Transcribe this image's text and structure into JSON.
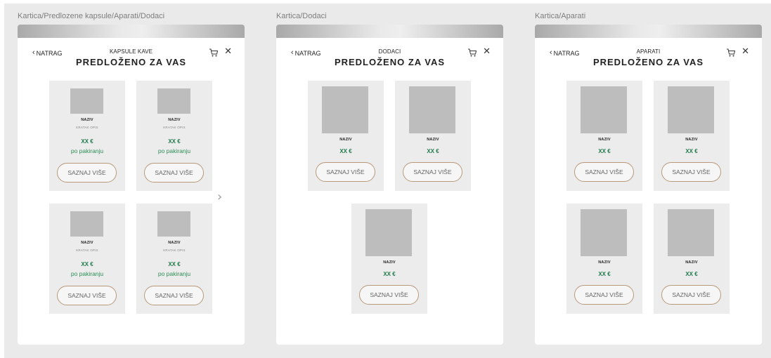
{
  "frames": [
    {
      "label": "Kartica/Predlozene kapsule/Aparati/Dodaci",
      "back": "NATRAG",
      "subtitle": "KAPSULE KAVE",
      "title": "PREDLOŽENO ZA VAS",
      "products": [
        {
          "name": "NAZIV",
          "desc": "KRATAK OPIS",
          "price": "XX €",
          "unit": "po pakiranju",
          "button": "SAZNAJ VIŠE"
        },
        {
          "name": "NAZIV",
          "desc": "KRATAK OPIS",
          "price": "XX €",
          "unit": "po pakiranju",
          "button": "SAZNAJ VIŠE"
        },
        {
          "name": "NAZIV",
          "desc": "KRATAK OPIS",
          "price": "XX €",
          "unit": "po pakiranju",
          "button": "SAZNAJ VIŠE"
        },
        {
          "name": "NAZIV",
          "desc": "KRATAK OPIS",
          "price": "XX €",
          "unit": "po pakiranju",
          "button": "SAZNAJ VIŠE"
        }
      ]
    },
    {
      "label": "Kartica/Dodaci",
      "back": "NATRAG",
      "subtitle": "DODACI",
      "title": "PREDLOŽENO ZA VAS",
      "products": [
        {
          "name": "NAZIV",
          "price": "XX €",
          "button": "SAZNAJ VIŠE"
        },
        {
          "name": "NAZIV",
          "price": "XX €",
          "button": "SAZNAJ VIŠE"
        },
        {
          "name": "NAZIV",
          "price": "XX €",
          "button": "SAZNAJ VIŠE"
        }
      ]
    },
    {
      "label": "Kartica/Aparati",
      "back": "NATRAG",
      "subtitle": "APARATI",
      "title": "PREDLOŽENO ZA VAS",
      "products": [
        {
          "name": "NAZIV",
          "price": "XX €",
          "button": "SAZNAJ VIŠE"
        },
        {
          "name": "NAZIV",
          "price": "XX €",
          "button": "SAZNAJ VIŠE"
        },
        {
          "name": "NAZIV",
          "price": "XX €",
          "button": "SAZNAJ VIŠE"
        },
        {
          "name": "NAZIV",
          "price": "XX €",
          "button": "SAZNAJ VIŠE"
        }
      ]
    }
  ],
  "icons": {
    "back": "chevron-left-icon",
    "cart": "cart-icon",
    "close": "close-icon",
    "next": "chevron-right-icon"
  },
  "colors": {
    "price": "#1f7a4a",
    "button_border": "#b89a7a",
    "card_bg": "#ececec",
    "placeholder": "#bdbdbd"
  }
}
